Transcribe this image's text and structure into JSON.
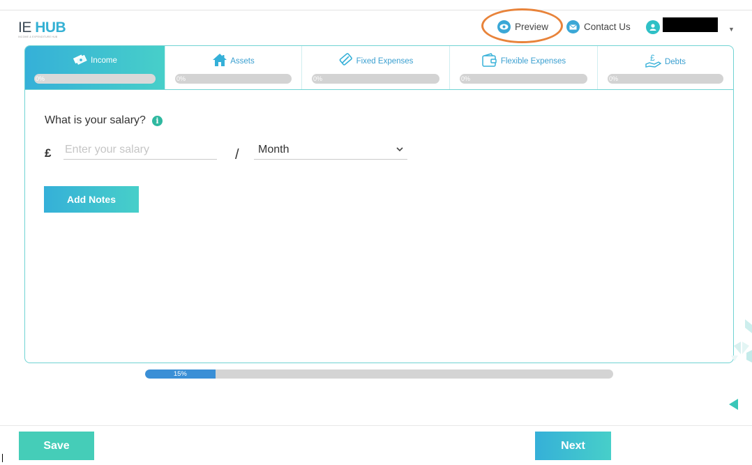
{
  "header": {
    "logo_main_ie": "IE",
    "logo_main_hub": "HUB",
    "logo_sub": "INCOME & EXPENDITURE HUB",
    "preview_label": "Preview",
    "contact_label": "Contact Us",
    "user_icon": "user-icon"
  },
  "tabs": [
    {
      "label": "Income",
      "progress": "0%",
      "icon": "income-icon",
      "active": true
    },
    {
      "label": "Assets",
      "progress": "0%",
      "icon": "house-icon",
      "active": false
    },
    {
      "label": "Fixed Expenses",
      "progress": "0%",
      "icon": "card-icon",
      "active": false
    },
    {
      "label": "Flexible Expenses",
      "progress": "0%",
      "icon": "wallet-icon",
      "active": false
    },
    {
      "label": "Debts",
      "progress": "0%",
      "icon": "pound-hand-icon",
      "active": false
    }
  ],
  "form": {
    "question": "What is your salary?",
    "currency": "£",
    "salary_placeholder": "Enter your salary",
    "salary_value": "",
    "separator": "/",
    "period_selected": "Month",
    "add_notes_label": "Add Notes"
  },
  "overall_progress": {
    "label": "15%",
    "value": 0.15
  },
  "footer": {
    "save_label": "Save",
    "next_label": "Next"
  },
  "colors": {
    "accent_gradient_start": "#35b0d8",
    "accent_gradient_end": "#47cfc9",
    "save_button": "#45cdb8",
    "highlight_ring": "#e8833a",
    "progress_fill": "#3a8fd6"
  }
}
